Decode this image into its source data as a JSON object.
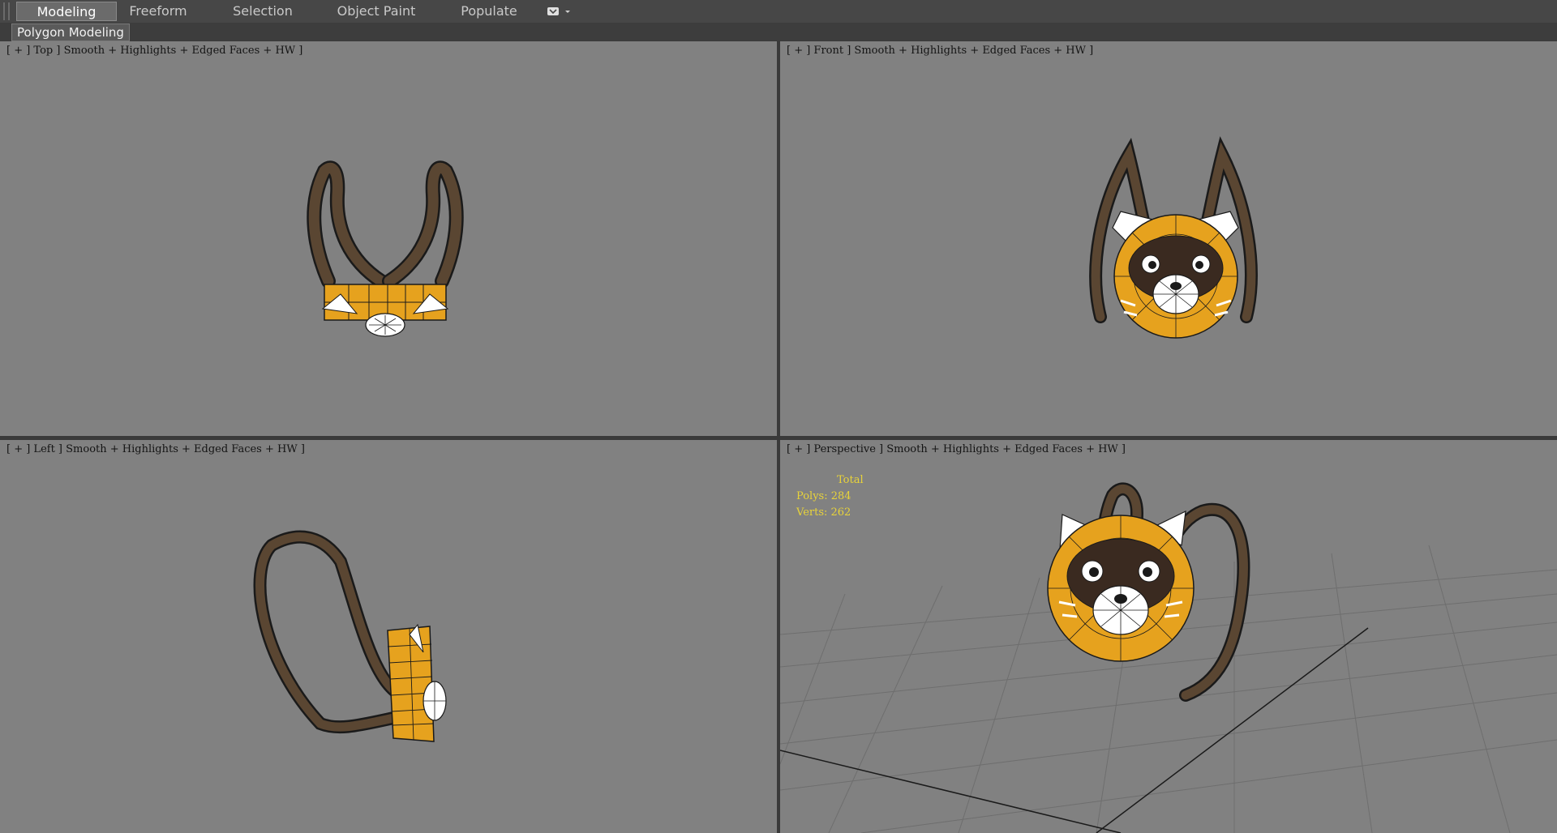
{
  "ribbon": {
    "tabs": [
      {
        "label": "Modeling",
        "active": true
      },
      {
        "label": "Freeform",
        "active": false
      },
      {
        "label": "Selection",
        "active": false
      },
      {
        "label": "Object Paint",
        "active": false
      },
      {
        "label": "Populate",
        "active": false
      }
    ],
    "more_icon": "chevron-down-icon"
  },
  "subbar": {
    "label": "Polygon Modeling"
  },
  "viewports": {
    "top": {
      "label": "[ + ] Top ] Smooth + Highlights + Edged Faces + HW ]"
    },
    "front": {
      "label": "[ + ] Front ] Smooth + Highlights + Edged Faces + HW ]"
    },
    "left": {
      "label": "[ + ] Left ] Smooth + Highlights + Edged Faces + HW ]"
    },
    "perspective": {
      "label": "[ + ] Perspective ] Smooth + Highlights + Edged Faces + HW ]"
    }
  },
  "stats": {
    "title": "Total",
    "polys": "Polys: 284",
    "verts": "Verts: 262"
  },
  "colors": {
    "viewport_bg": "#818181",
    "strap": "#5a4632",
    "body_orange": "#e6a21e",
    "mask_dark": "#3a2a20",
    "stats_text": "#e8d33a",
    "wire": "#1a1a1a"
  }
}
